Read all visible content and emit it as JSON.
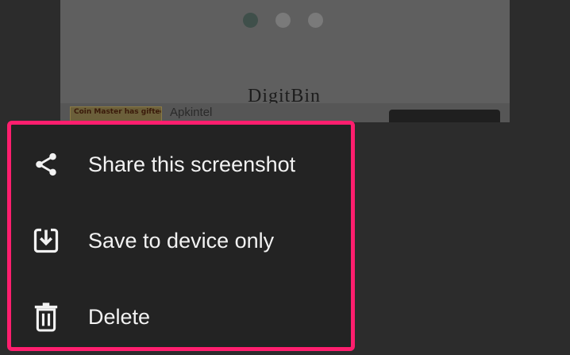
{
  "preview": {
    "brand": "DigitBin",
    "ad": {
      "thumb_text": "Coin Master has gifted you spins and coins!",
      "source": "Apkintel"
    }
  },
  "menu": {
    "items": [
      {
        "label": "Share this screenshot",
        "icon": "share-icon"
      },
      {
        "label": "Save to device only",
        "icon": "download-icon"
      },
      {
        "label": "Delete",
        "icon": "trash-icon"
      }
    ]
  },
  "colors": {
    "highlight_border": "#ff1e6e",
    "sheet_background": "#232323",
    "text": "#f2f2f2"
  }
}
